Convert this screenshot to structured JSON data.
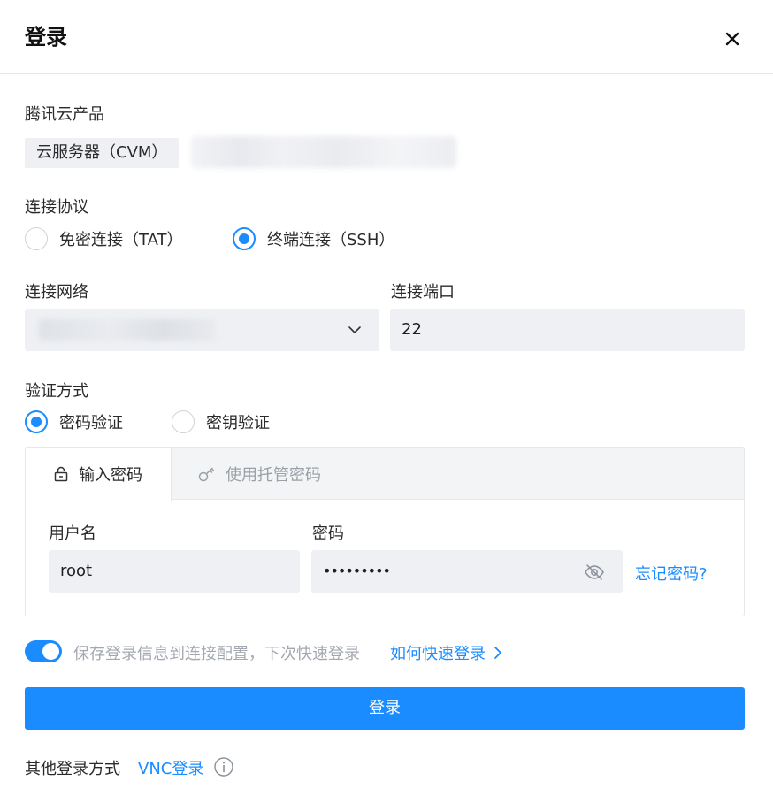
{
  "dialog": {
    "title": "登录",
    "close_icon": "close-icon"
  },
  "product": {
    "label": "腾讯云产品",
    "tag": "云服务器（CVM）"
  },
  "protocol": {
    "label": "连接协议",
    "options": [
      {
        "label": "免密连接（TAT）",
        "selected": false
      },
      {
        "label": "终端连接（SSH）",
        "selected": true
      }
    ]
  },
  "network": {
    "label": "连接网络"
  },
  "port": {
    "label": "连接端口",
    "value": "22"
  },
  "auth": {
    "label": "验证方式",
    "options": [
      {
        "label": "密码验证",
        "selected": true
      },
      {
        "label": "密钥验证",
        "selected": false
      }
    ],
    "tabs": [
      {
        "label": "输入密码",
        "icon": "lock-icon",
        "active": true
      },
      {
        "label": "使用托管密码",
        "icon": "key-icon",
        "active": false
      }
    ],
    "username_label": "用户名",
    "username_value": "root",
    "password_label": "密码",
    "password_value": "•••••••••",
    "forgot_link": "忘记密码?"
  },
  "save": {
    "text": "保存登录信息到连接配置，下次快速登录",
    "link": "如何快速登录",
    "enabled": true
  },
  "login_button": "登录",
  "other": {
    "label": "其他登录方式",
    "vnc_link": "VNC登录"
  },
  "colors": {
    "accent": "#1a8cff",
    "field_bg": "#eef0f3"
  }
}
